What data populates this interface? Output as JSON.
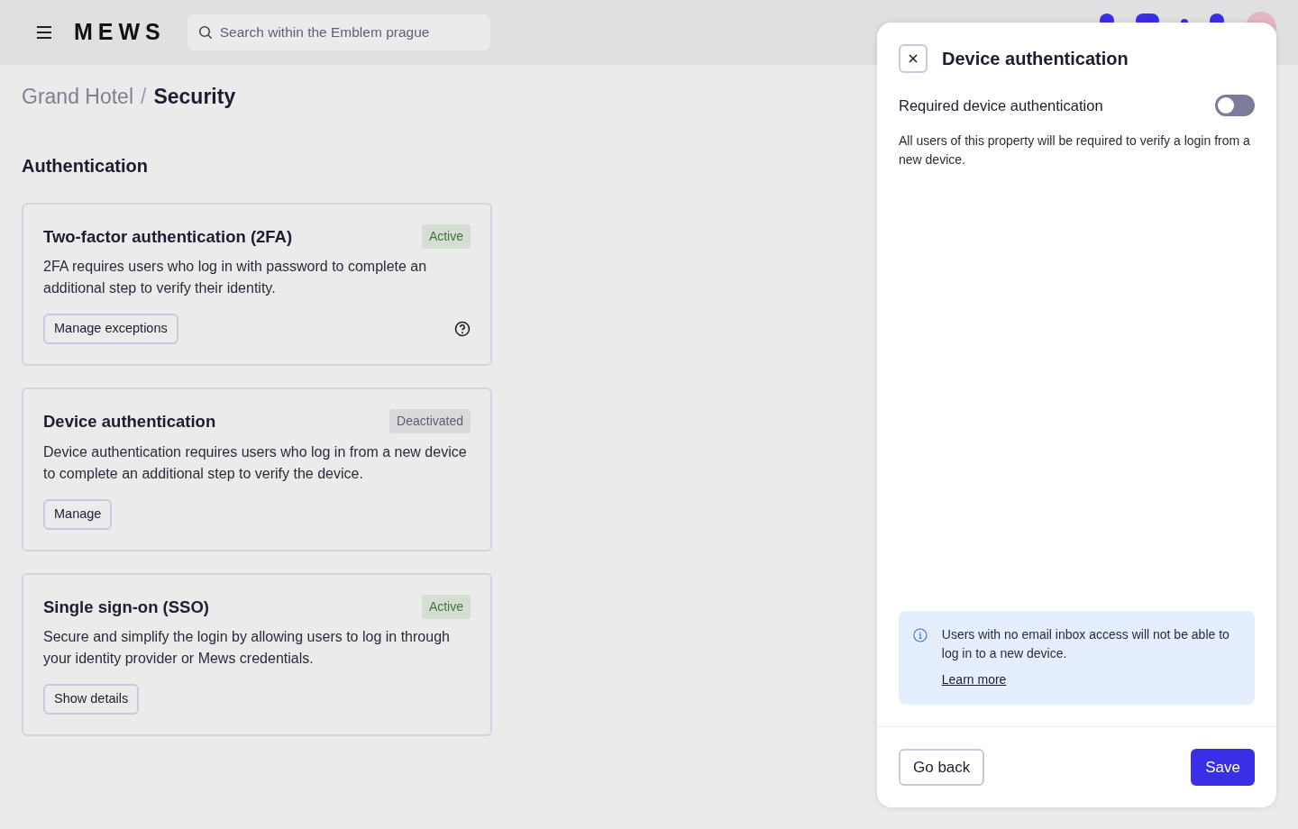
{
  "header": {
    "logo": "MEWS",
    "search": {
      "placeholder": "Search within the Emblem prague"
    },
    "badges": [
      {
        "kind": "round"
      },
      {
        "kind": "wide"
      },
      {
        "kind": "dot"
      },
      {
        "kind": "round"
      }
    ]
  },
  "breadcrumb": [
    {
      "label": "Grand Hotel",
      "current": false
    },
    {
      "label": "Security",
      "current": true
    }
  ],
  "breadcrumb_separator": "/",
  "section_title": "Authentication",
  "cards": [
    {
      "title": "Two-factor authentication (2FA)",
      "status": "Active",
      "color": "#3c7a33",
      "description": "2FA requires users who log in with password to complete an additional step to verify their identity.",
      "button": "Manage exceptions",
      "help": true
    },
    {
      "title": "Device authentication",
      "status": "Deactivated",
      "color": "#5e5f70",
      "description": "Device authentication requires users who log in from a new device to complete an additional step to verify the device.",
      "button": "Manage",
      "help": false
    },
    {
      "title": "Single sign-on (SSO)",
      "status": "Active",
      "color": "#3c7a33",
      "description": "Secure and simplify the login by allowing users to log in through your identity provider or Mews credentials.",
      "button": "Show details",
      "help": false
    }
  ],
  "panel": {
    "title": "Device authentication",
    "toggle": {
      "label": "Required device authentication",
      "on": false
    },
    "description": "All users of this property will be required to verify a login from a new device.",
    "info": {
      "text": "Users with no email inbox access will not be able to log in to a new device.",
      "link": "Learn more"
    },
    "buttons": [
      {
        "label": "Go back",
        "kind": "secondary"
      },
      {
        "label": "Save",
        "kind": "primary"
      }
    ]
  }
}
